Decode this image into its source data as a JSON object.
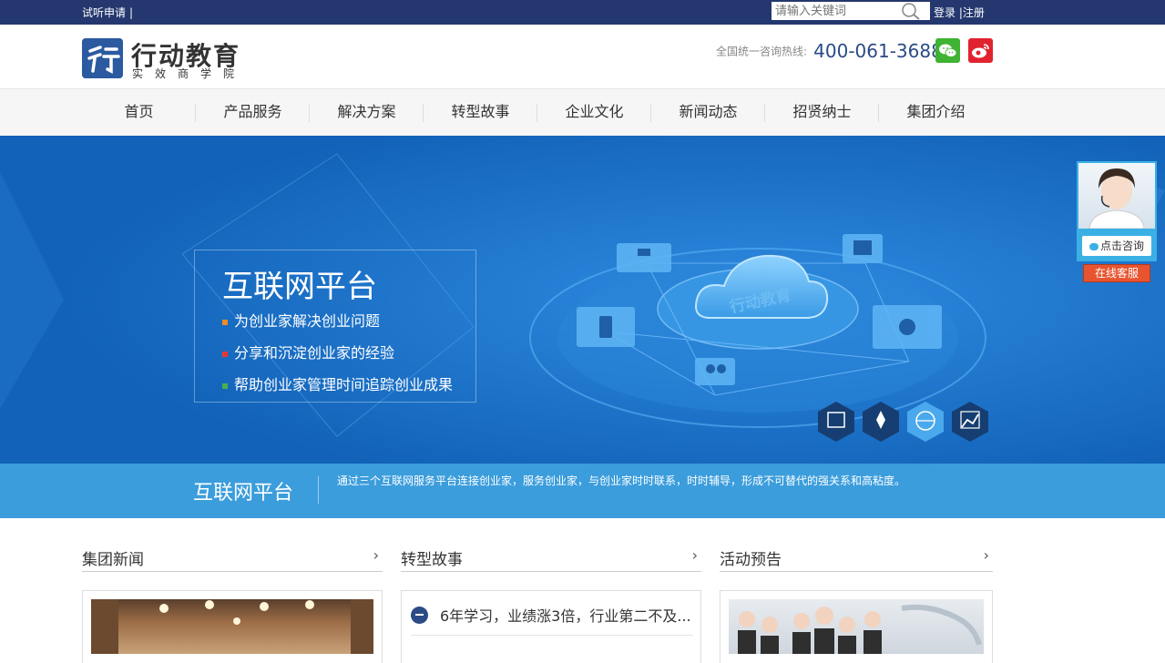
{
  "topbar": {
    "trial_label": "试听申请",
    "trial_sep": "|",
    "search_placeholder": "请输入关键词",
    "login_label": "登录",
    "link_sep": " |",
    "register_label": "注册"
  },
  "header": {
    "logo_name": "行动教育",
    "logo_sub": "实效商学院",
    "hotline_label": "全国统一咨询热线:",
    "hotline_number": "400-061-3688"
  },
  "nav": {
    "items": [
      {
        "label": "首页"
      },
      {
        "label": "产品服务"
      },
      {
        "label": "解决方案"
      },
      {
        "label": "转型故事"
      },
      {
        "label": "企业文化"
      },
      {
        "label": "新闻动态"
      },
      {
        "label": "招贤纳士"
      },
      {
        "label": "集团介绍"
      }
    ]
  },
  "banner": {
    "title": "互联网平台",
    "items": [
      {
        "text": "为创业家解决创业问题",
        "bullet_color": "#f08a24"
      },
      {
        "text": "分享和沉淀创业家的经验",
        "bullet_color": "#e53935"
      },
      {
        "text": "帮助创业家管理时间追踪创业成果",
        "bullet_color": "#4caf50"
      }
    ],
    "cloud_text": "行动教育"
  },
  "strip": {
    "title": "互联网平台",
    "description": "通过三个互联网服务平台连接创业家，服务创业家，与创业家时时联系，时时辅导，形成不可替代的强关系和高粘度。"
  },
  "sections": {
    "news": {
      "title": "集团新闻",
      "arrow": "›"
    },
    "stories": {
      "title": "转型故事",
      "arrow": "›",
      "first_item": "6年学习，业绩涨3倍，行业第二不及..."
    },
    "events": {
      "title": "活动预告",
      "arrow": "›"
    }
  },
  "float_consult": {
    "consult_label": "点击咨询",
    "online_label": "在线客服"
  },
  "colors": {
    "topbar": "#24386f",
    "banner": "#1670c9",
    "strip": "#3b9ddc",
    "accent": "#2b4b86"
  }
}
